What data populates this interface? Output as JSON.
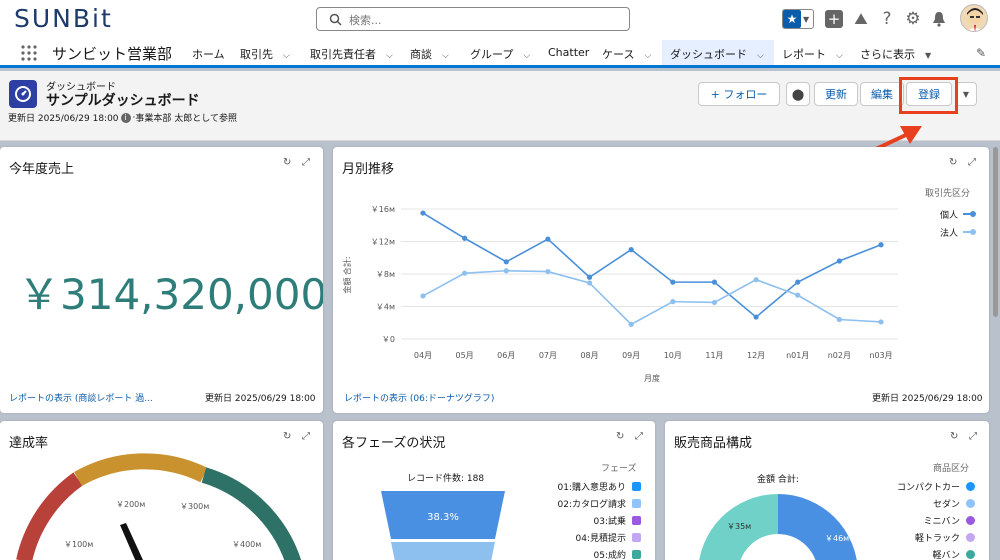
{
  "app": {
    "logo": "SUNBIT",
    "search_placeholder": "検索...",
    "app_name": "サンビット営業部"
  },
  "nav": {
    "items": [
      "ホーム",
      "取引先",
      "取引先責任者",
      "商談",
      "グループ",
      "Chatter",
      "ケース",
      "ダッシュボード",
      "レポート",
      "さらに表示"
    ]
  },
  "dashboard": {
    "type_label": "ダッシュボード",
    "title": "サンプルダッシュボード",
    "meta": "更新日 2025/06/29 18:00",
    "meta_viewer": "事業本部 太郎として参照",
    "buttons": {
      "follow": "+ フォロー",
      "refresh": "更新",
      "edit": "編集",
      "subscribe": "登録"
    }
  },
  "cards": {
    "sales": {
      "title": "今年度売上",
      "value": "￥314,320,000",
      "link": "レポートの表示 (商談レポート 過...",
      "date": "更新日 2025/06/29 18:00"
    },
    "monthly": {
      "title": "月別推移",
      "link": "レポートの表示 (06:ドーナツグラフ)",
      "date": "更新日 2025/06/29 18:00",
      "ylabel": "金額 合計:",
      "xlabel": "月度",
      "legend_title": "取引先区分"
    },
    "achievement": {
      "title": "達成率",
      "ticks": [
        "￥100м",
        "￥200м",
        "￥300м",
        "￥400м"
      ]
    },
    "phases": {
      "title": "各フェーズの状況",
      "record_count": "レコード件数: 188",
      "legend_title": "フェーズ",
      "legend": [
        "01:購入意思あり",
        "02:カタログ請求",
        "03:試乗",
        "04:見積提示",
        "05:成約"
      ],
      "colors": [
        "#1b96ff",
        "#90c3f9",
        "#9b59e0",
        "#c3a6f2",
        "#3ba99c"
      ],
      "top_pct": "38.3%"
    },
    "products": {
      "title": "販売商品構成",
      "subtitle": "金額 合計:",
      "legend_title": "商品区分",
      "legend": [
        "コンパクトカー",
        "セダン",
        "ミニバン",
        "軽トラック",
        "軽バン"
      ],
      "colors": [
        "#1b96ff",
        "#90c3f9",
        "#9b59e0",
        "#c3a6f2",
        "#3ba99c"
      ],
      "label_a": "￥46м",
      "label_b": "￥35м"
    }
  },
  "chart_data": {
    "type": "line",
    "categories": [
      "04月",
      "05月",
      "06月",
      "07月",
      "08月",
      "09月",
      "10月",
      "11月",
      "12月",
      "n01月",
      "n02月",
      "n03月"
    ],
    "series": [
      {
        "name": "個人",
        "color": "#4a90d9",
        "values": [
          15.5,
          12.4,
          9.5,
          12.3,
          7.6,
          11.0,
          7.0,
          7.0,
          2.7,
          7.0,
          9.6,
          11.6
        ]
      },
      {
        "name": "法人",
        "color": "#8ec0ef",
        "values": [
          5.3,
          8.1,
          8.4,
          8.3,
          6.9,
          1.8,
          4.6,
          4.5,
          7.3,
          5.4,
          2.4,
          2.1
        ]
      }
    ],
    "ylim": [
      0,
      16
    ],
    "yticks": [
      "￥0",
      "￥4м",
      "￥8м",
      "￥12м",
      "￥16м"
    ],
    "xlabel": "月度",
    "ylabel": "金額 合計:",
    "grid": true,
    "legend": "top-right"
  }
}
